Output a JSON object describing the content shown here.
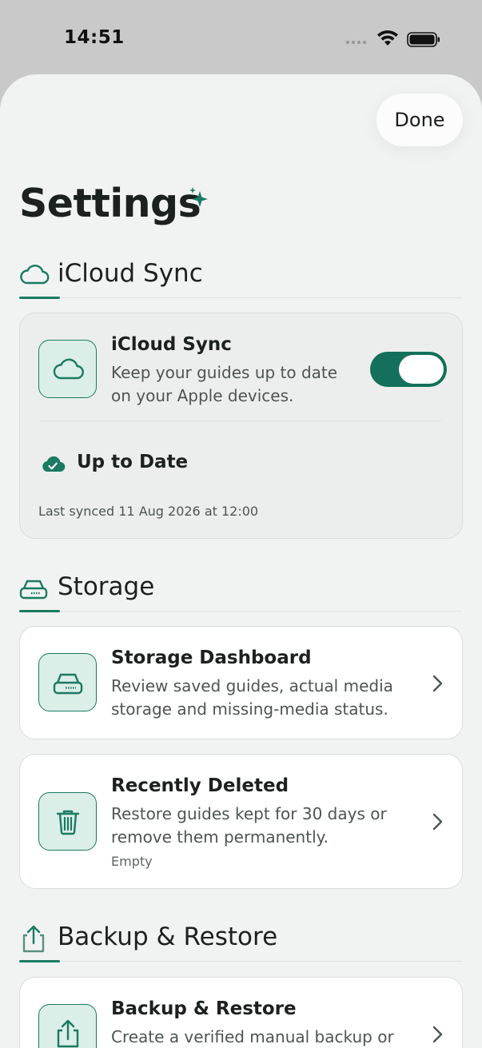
{
  "status_bar": {
    "time": "14:51"
  },
  "header": {
    "done_label": "Done",
    "title": "Settings"
  },
  "sections": {
    "icloud": {
      "title": "iCloud Sync",
      "card": {
        "title": "iCloud Sync",
        "description": "Keep your guides up to date on your Apple devices.",
        "toggle_on": true,
        "status": "Up to Date",
        "last_synced": "Last synced 11 Aug 2026 at 12:00"
      }
    },
    "storage": {
      "title": "Storage",
      "dashboard": {
        "title": "Storage Dashboard",
        "description": "Review saved guides, actual media storage and missing-media status."
      },
      "recently_deleted": {
        "title": "Recently Deleted",
        "description": "Restore guides kept for 30 days or remove them permanently.",
        "note": "Empty"
      }
    },
    "backup": {
      "title": "Backup & Restore",
      "card": {
        "title": "Backup & Restore",
        "description": "Create a verified manual backup or"
      }
    }
  },
  "colors": {
    "accent": "#1a7a62",
    "sheet_bg": "#f1f3f2",
    "tile_bg": "#dbeee7"
  }
}
